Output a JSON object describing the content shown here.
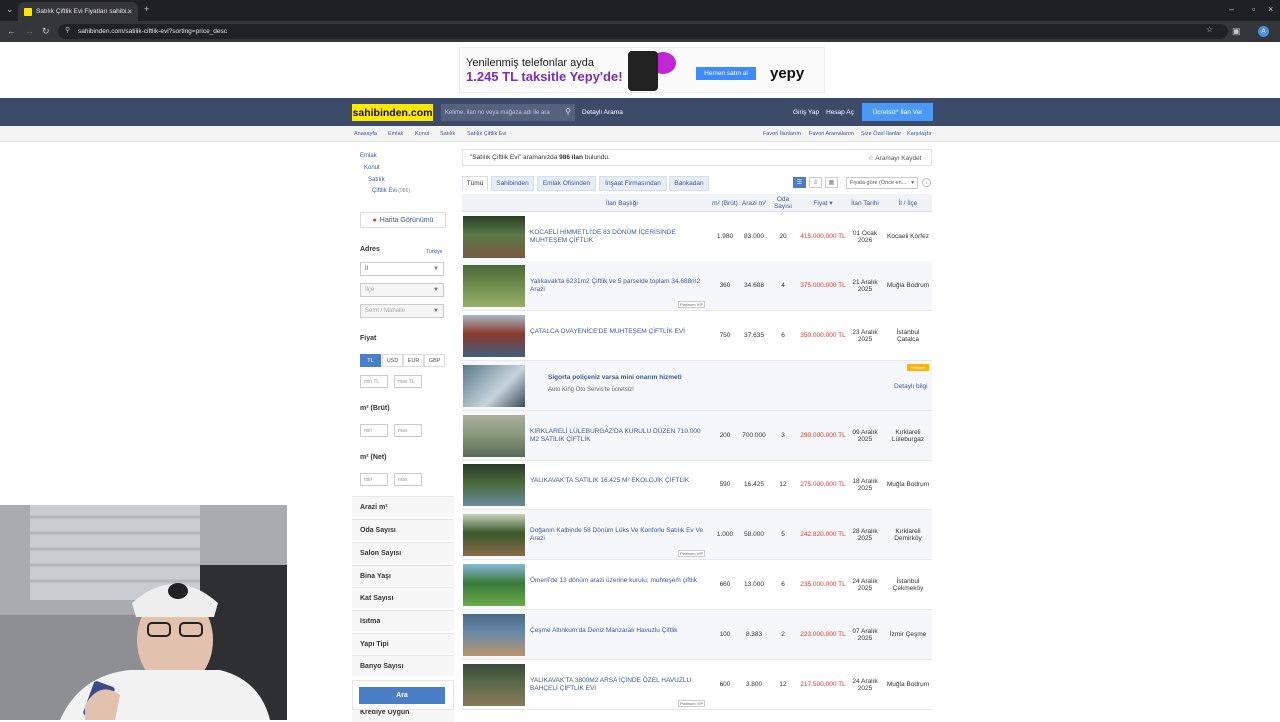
{
  "browser": {
    "tab_title": "Satılık Çiftlik Evi Fiyatları sahibi...",
    "url": "sahibinden.com/satilik-ciftlik-evi?sorting=price_desc"
  },
  "ad_banner": {
    "line1": "Yenilenmiş telefonlar ayda",
    "line2": "1.245 TL taksitle Yepy'de!",
    "button": "Hemen satın al",
    "brand": "yepy"
  },
  "header": {
    "logo": "sahibinden.com",
    "search_placeholder": "Kelime, ilan no veya mağaza adı ile ara",
    "detailed_search": "Detaylı Arama",
    "login": "Giriş Yap",
    "register": "Hesap Aç",
    "post_ad": "Ücretsiz* İlan Ver"
  },
  "breadcrumb": {
    "items": [
      "Anasayfa",
      "Emlak",
      "Konut",
      "Satılık",
      "Satılık Çiftlik Evi"
    ],
    "right": [
      "Favori İlanlarım",
      "Favori Aramalarım",
      "Size Özel İlanlar",
      "Karşılaştır"
    ]
  },
  "sidebar": {
    "categories": [
      "Emlak",
      "Konut",
      "Satılık",
      "Çiftlik Evi"
    ],
    "category_count": "(986)",
    "map_button": "Harita Görünümü",
    "address_label": "Adres",
    "address_country": "Türkiye",
    "il": "İl",
    "ilce": "İlçe",
    "semt": "Semt / Mahalle",
    "price_label": "Fiyat",
    "currencies": [
      "TL",
      "USD",
      "EUR",
      "GBP"
    ],
    "min_tl": "min TL",
    "max_tl": "max TL",
    "m2_brut": "m² (Brüt)",
    "m2_net": "m² (Net)",
    "min": "min",
    "max": "max",
    "filters": [
      "Arazi m²",
      "Oda Sayısı",
      "Salon Sayısı",
      "Bina Yaşı",
      "Kat Sayısı",
      "Isıtma",
      "Yapı Tipi",
      "Banyo Sayısı"
    ],
    "last_filter": "Krediye Uygun",
    "search_button": "Ara"
  },
  "results": {
    "summary_pre": "\"Satılık Çiftlik Evi\" aramanızda",
    "summary_count": "986 ilan",
    "summary_post": "bulundu.",
    "save_search": "Aramayı Kaydet",
    "tabs": [
      "Tümü",
      "Sahibinden",
      "Emlak Ofisinden",
      "İnşaat Firmasından",
      "Bankadan"
    ],
    "sort": "Fiyata göre (Önce en...",
    "columns": {
      "title": "İlan Başlığı",
      "m2_brut": "m² (Brüt)",
      "arazi": "Arazi m²",
      "oda": "Oda Sayısı",
      "price": "Fiyat",
      "date": "İlan Tarihi",
      "location": "İl / İlçe"
    },
    "rows": [
      {
        "title": "KOCAELİ HİMMETLİ'DE 83 DÖNÜM İÇERİSİNDE MUHTEŞEM ÇİFTLİK",
        "m2": "1.980",
        "arazi": "83.000",
        "oda": "20",
        "price": "415.000.000 TL",
        "date": "01 Ocak 2026",
        "loc": "Kocaeli Körfez"
      },
      {
        "title": "Yalıkavak'ta 6231m2 Çiftlik ve 5 parselde toplam 34.688m2 Arazi",
        "m2": "360",
        "arazi": "34.688",
        "oda": "4",
        "price": "375.000.000 TL",
        "date": "21 Aralık 2025",
        "loc": "Muğla Bodrum",
        "badge": "Platinum VİP"
      },
      {
        "title": "ÇATALCA OVAYENİCE'DE MUHTEŞEM ÇİFTLİK EVİ",
        "m2": "750",
        "arazi": "37.635",
        "oda": "6",
        "price": "350.000.000 TL",
        "date": "23 Aralık 2025",
        "loc": "İstanbul Çatalca"
      },
      {
        "title": "KIRKLARELİ LÜLEBURGAZ'DA KURULU DÜZEN 710.000 M2 SATILIK ÇİFTLİK",
        "m2": "200",
        "arazi": "700.000",
        "oda": "3",
        "price": "290.000.000 TL",
        "date": "09 Aralık 2025",
        "loc": "Kırklareli Lüleburgaz"
      },
      {
        "title": "YALIKAVAK'TA SATILIK 16.425 M² EKOLOJİK ÇİFTLİK",
        "m2": "590",
        "arazi": "16.425",
        "oda": "12",
        "price": "275.000.000 TL",
        "date": "18 Aralık 2025",
        "loc": "Muğla Bodrum"
      },
      {
        "title": "Doğanın Kalbinde 58 Dönüm Lüks Ve Konforlu Satılık Ev Ve Arazi",
        "m2": "1.000",
        "arazi": "58.000",
        "oda": "5",
        "price": "242.820.000 TL",
        "date": "28 Aralık 2025",
        "loc": "Kırklareli Demirköy",
        "badge": "Platinum VİP"
      },
      {
        "title": "Ömerli'de 13 dönüm arazi üzerine kurulu; muhteşem çiftlik",
        "m2": "660",
        "arazi": "13.000",
        "oda": "6",
        "price": "235.000.000 TL",
        "date": "24 Aralık 2025",
        "loc": "İstanbul Çekmeköy"
      },
      {
        "title": "Çeşme Altınkum'da Deniz Manzaralı Havuzlu Çiftlik",
        "m2": "100",
        "arazi": "8.383",
        "oda": "2",
        "price": "223.000.000 TL",
        "date": "07 Aralık 2025",
        "loc": "İzmir Çeşme"
      },
      {
        "title": "YALIKAVAK'TA 3800M2 ARSA İÇİNDE ÖZEL HAVUZLU BAHÇELİ ÇİFTLİK EVİ",
        "m2": "600",
        "arazi": "3.800",
        "oda": "12",
        "price": "217.500.000 TL",
        "date": "24 Aralık 2025",
        "loc": "Muğla Bodrum",
        "badge": "Platinum VİP"
      }
    ],
    "ad_row": {
      "title": "Sigorta poliçeniz varsa mini onarım hizmeti",
      "subtitle": "Auto King Oto Servis'te ücretsiz!",
      "link": "Detaylı bilgi",
      "tag": "Reklam"
    }
  }
}
